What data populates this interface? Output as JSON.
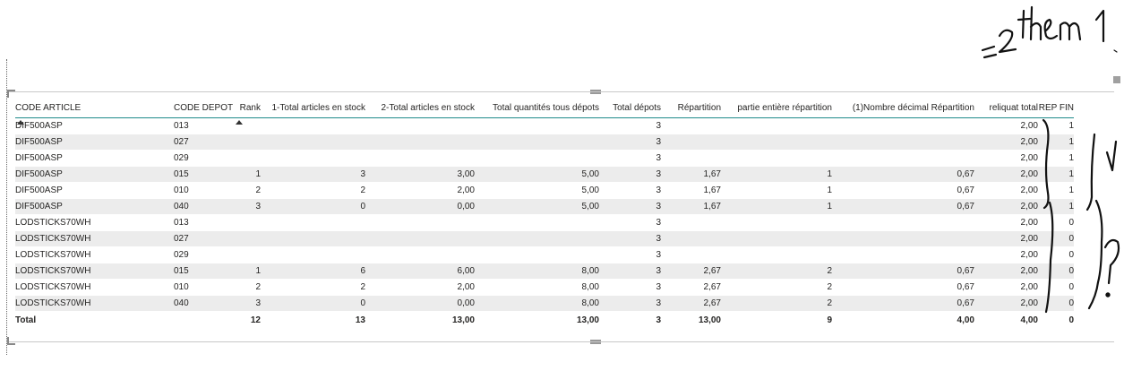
{
  "columns": [
    {
      "key": "code_article",
      "label": "CODE ARTICLE",
      "align": "left"
    },
    {
      "key": "code_depot",
      "label": "CODE DEPOT",
      "align": "left"
    },
    {
      "key": "rank",
      "label": "Rank",
      "align": "right"
    },
    {
      "key": "total1",
      "label": "1-Total articles en stock",
      "align": "right"
    },
    {
      "key": "total2",
      "label": "2-Total articles en stock",
      "align": "right"
    },
    {
      "key": "total_qte",
      "label": "Total quantités tous dépots",
      "align": "right"
    },
    {
      "key": "total_depots",
      "label": "Total dépots",
      "align": "right"
    },
    {
      "key": "repartition",
      "label": "Répartition",
      "align": "right"
    },
    {
      "key": "partie_entiere",
      "label": "partie entière répartition",
      "align": "right"
    },
    {
      "key": "nb_decimal",
      "label": "(1)Nombre décimal Répartition",
      "align": "right"
    },
    {
      "key": "reliquat",
      "label": "reliquat total",
      "align": "right"
    },
    {
      "key": "rep_fin",
      "label": "REP FIN",
      "align": "right"
    }
  ],
  "rows": [
    [
      "DIF500ASP",
      "013",
      "",
      "",
      "",
      "",
      "3",
      "",
      "",
      "",
      "2,00",
      "1"
    ],
    [
      "DIF500ASP",
      "027",
      "",
      "",
      "",
      "",
      "3",
      "",
      "",
      "",
      "2,00",
      "1"
    ],
    [
      "DIF500ASP",
      "029",
      "",
      "",
      "",
      "",
      "3",
      "",
      "",
      "",
      "2,00",
      "1"
    ],
    [
      "DIF500ASP",
      "015",
      "1",
      "3",
      "3,00",
      "5,00",
      "3",
      "1,67",
      "1",
      "0,67",
      "2,00",
      "1"
    ],
    [
      "DIF500ASP",
      "010",
      "2",
      "2",
      "2,00",
      "5,00",
      "3",
      "1,67",
      "1",
      "0,67",
      "2,00",
      "1"
    ],
    [
      "DIF500ASP",
      "040",
      "3",
      "0",
      "0,00",
      "5,00",
      "3",
      "1,67",
      "1",
      "0,67",
      "2,00",
      "1"
    ],
    [
      "LODSTICKS70WH",
      "013",
      "",
      "",
      "",
      "",
      "3",
      "",
      "",
      "",
      "2,00",
      "0"
    ],
    [
      "LODSTICKS70WH",
      "027",
      "",
      "",
      "",
      "",
      "3",
      "",
      "",
      "",
      "2,00",
      "0"
    ],
    [
      "LODSTICKS70WH",
      "029",
      "",
      "",
      "",
      "",
      "3",
      "",
      "",
      "",
      "2,00",
      "0"
    ],
    [
      "LODSTICKS70WH",
      "015",
      "1",
      "6",
      "6,00",
      "8,00",
      "3",
      "2,67",
      "2",
      "0,67",
      "2,00",
      "0"
    ],
    [
      "LODSTICKS70WH",
      "010",
      "2",
      "2",
      "2,00",
      "8,00",
      "3",
      "2,67",
      "2",
      "0,67",
      "2,00",
      "0"
    ],
    [
      "LODSTICKS70WH",
      "040",
      "3",
      "0",
      "0,00",
      "8,00",
      "3",
      "2,67",
      "2",
      "0,67",
      "2,00",
      "0"
    ]
  ],
  "total": [
    "Total",
    "",
    "12",
    "13",
    "13,00",
    "13,00",
    "3",
    "13,00",
    "9",
    "4,00",
    "4,00",
    "0"
  ],
  "sorted_columns": [
    "code_article",
    "rank"
  ],
  "handwritten_note": "=2them 1",
  "handwritten_marks": [
    "V",
    "?"
  ],
  "colors": {
    "header_rule": "#1f8a8a",
    "stripe": "#ececec",
    "text": "#252423"
  }
}
